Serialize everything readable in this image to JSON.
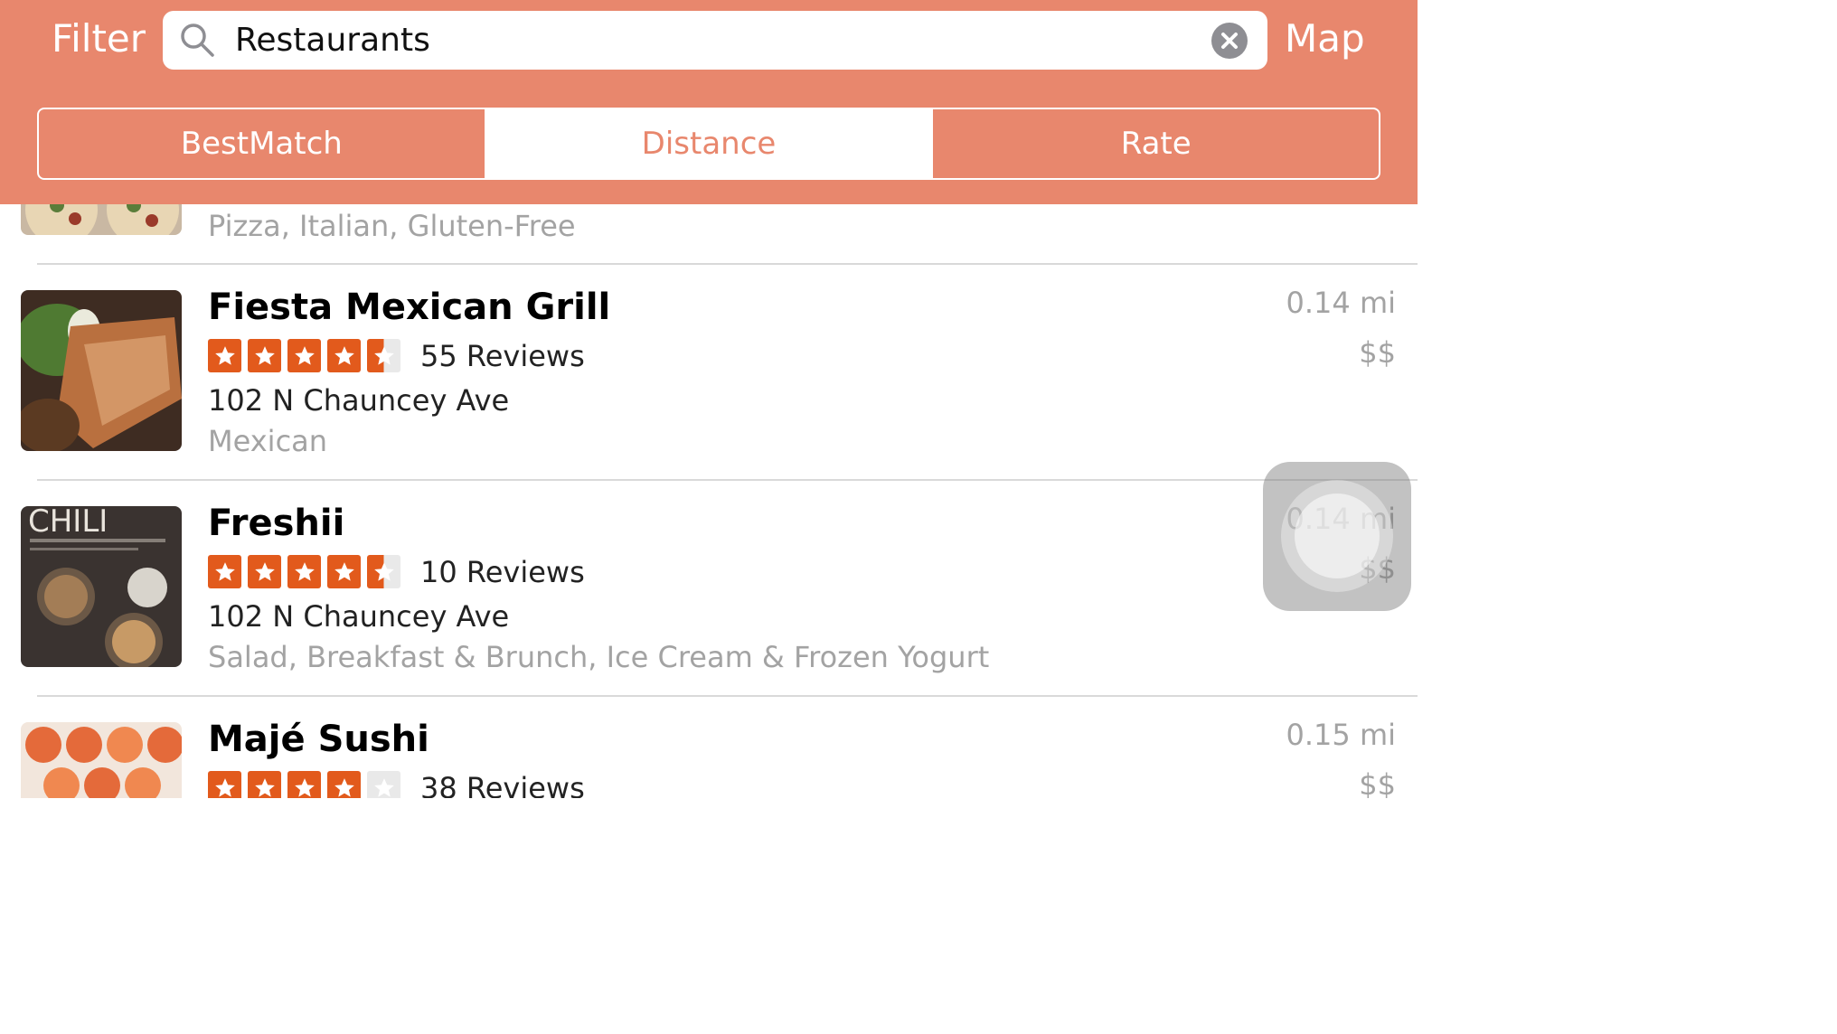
{
  "header": {
    "filter_label": "Filter",
    "map_label": "Map",
    "search": {
      "value": "Restaurants",
      "placeholder": ""
    },
    "segments": [
      "BestMatch",
      "Distance",
      "Rate"
    ],
    "selected_segment": "Distance"
  },
  "colors": {
    "accent": "#e8876d",
    "star": "#e25a1c",
    "secondary_text": "#a3a3a3"
  },
  "results": [
    {
      "name": "",
      "categories": "Pizza, Italian, Gluten-Free",
      "thumbnail": "pizza-photo"
    },
    {
      "name": "Fiesta Mexican Grill",
      "rating": 4.5,
      "reviews": "55 Reviews",
      "address": "102 N Chauncey Ave",
      "categories": "Mexican",
      "distance": "0.14 mi",
      "price": "$$",
      "thumbnail": "burrito-photo"
    },
    {
      "name": "Freshii",
      "rating": 4.5,
      "reviews": "10 Reviews",
      "address": "102 N Chauncey Ave",
      "categories": "Salad, Breakfast & Brunch, Ice Cream & Frozen Yogurt",
      "distance": "0.14 mi",
      "price": "$$",
      "thumbnail": "menu-board-photo",
      "thumb_text": "CHILI"
    },
    {
      "name": "Majé Sushi",
      "rating": 4,
      "reviews": "38 Reviews",
      "distance": "0.15 mi",
      "price": "$$",
      "thumbnail": "sushi-photo"
    }
  ],
  "overlay": {
    "assistive_touch": "assistive-touch-button"
  }
}
